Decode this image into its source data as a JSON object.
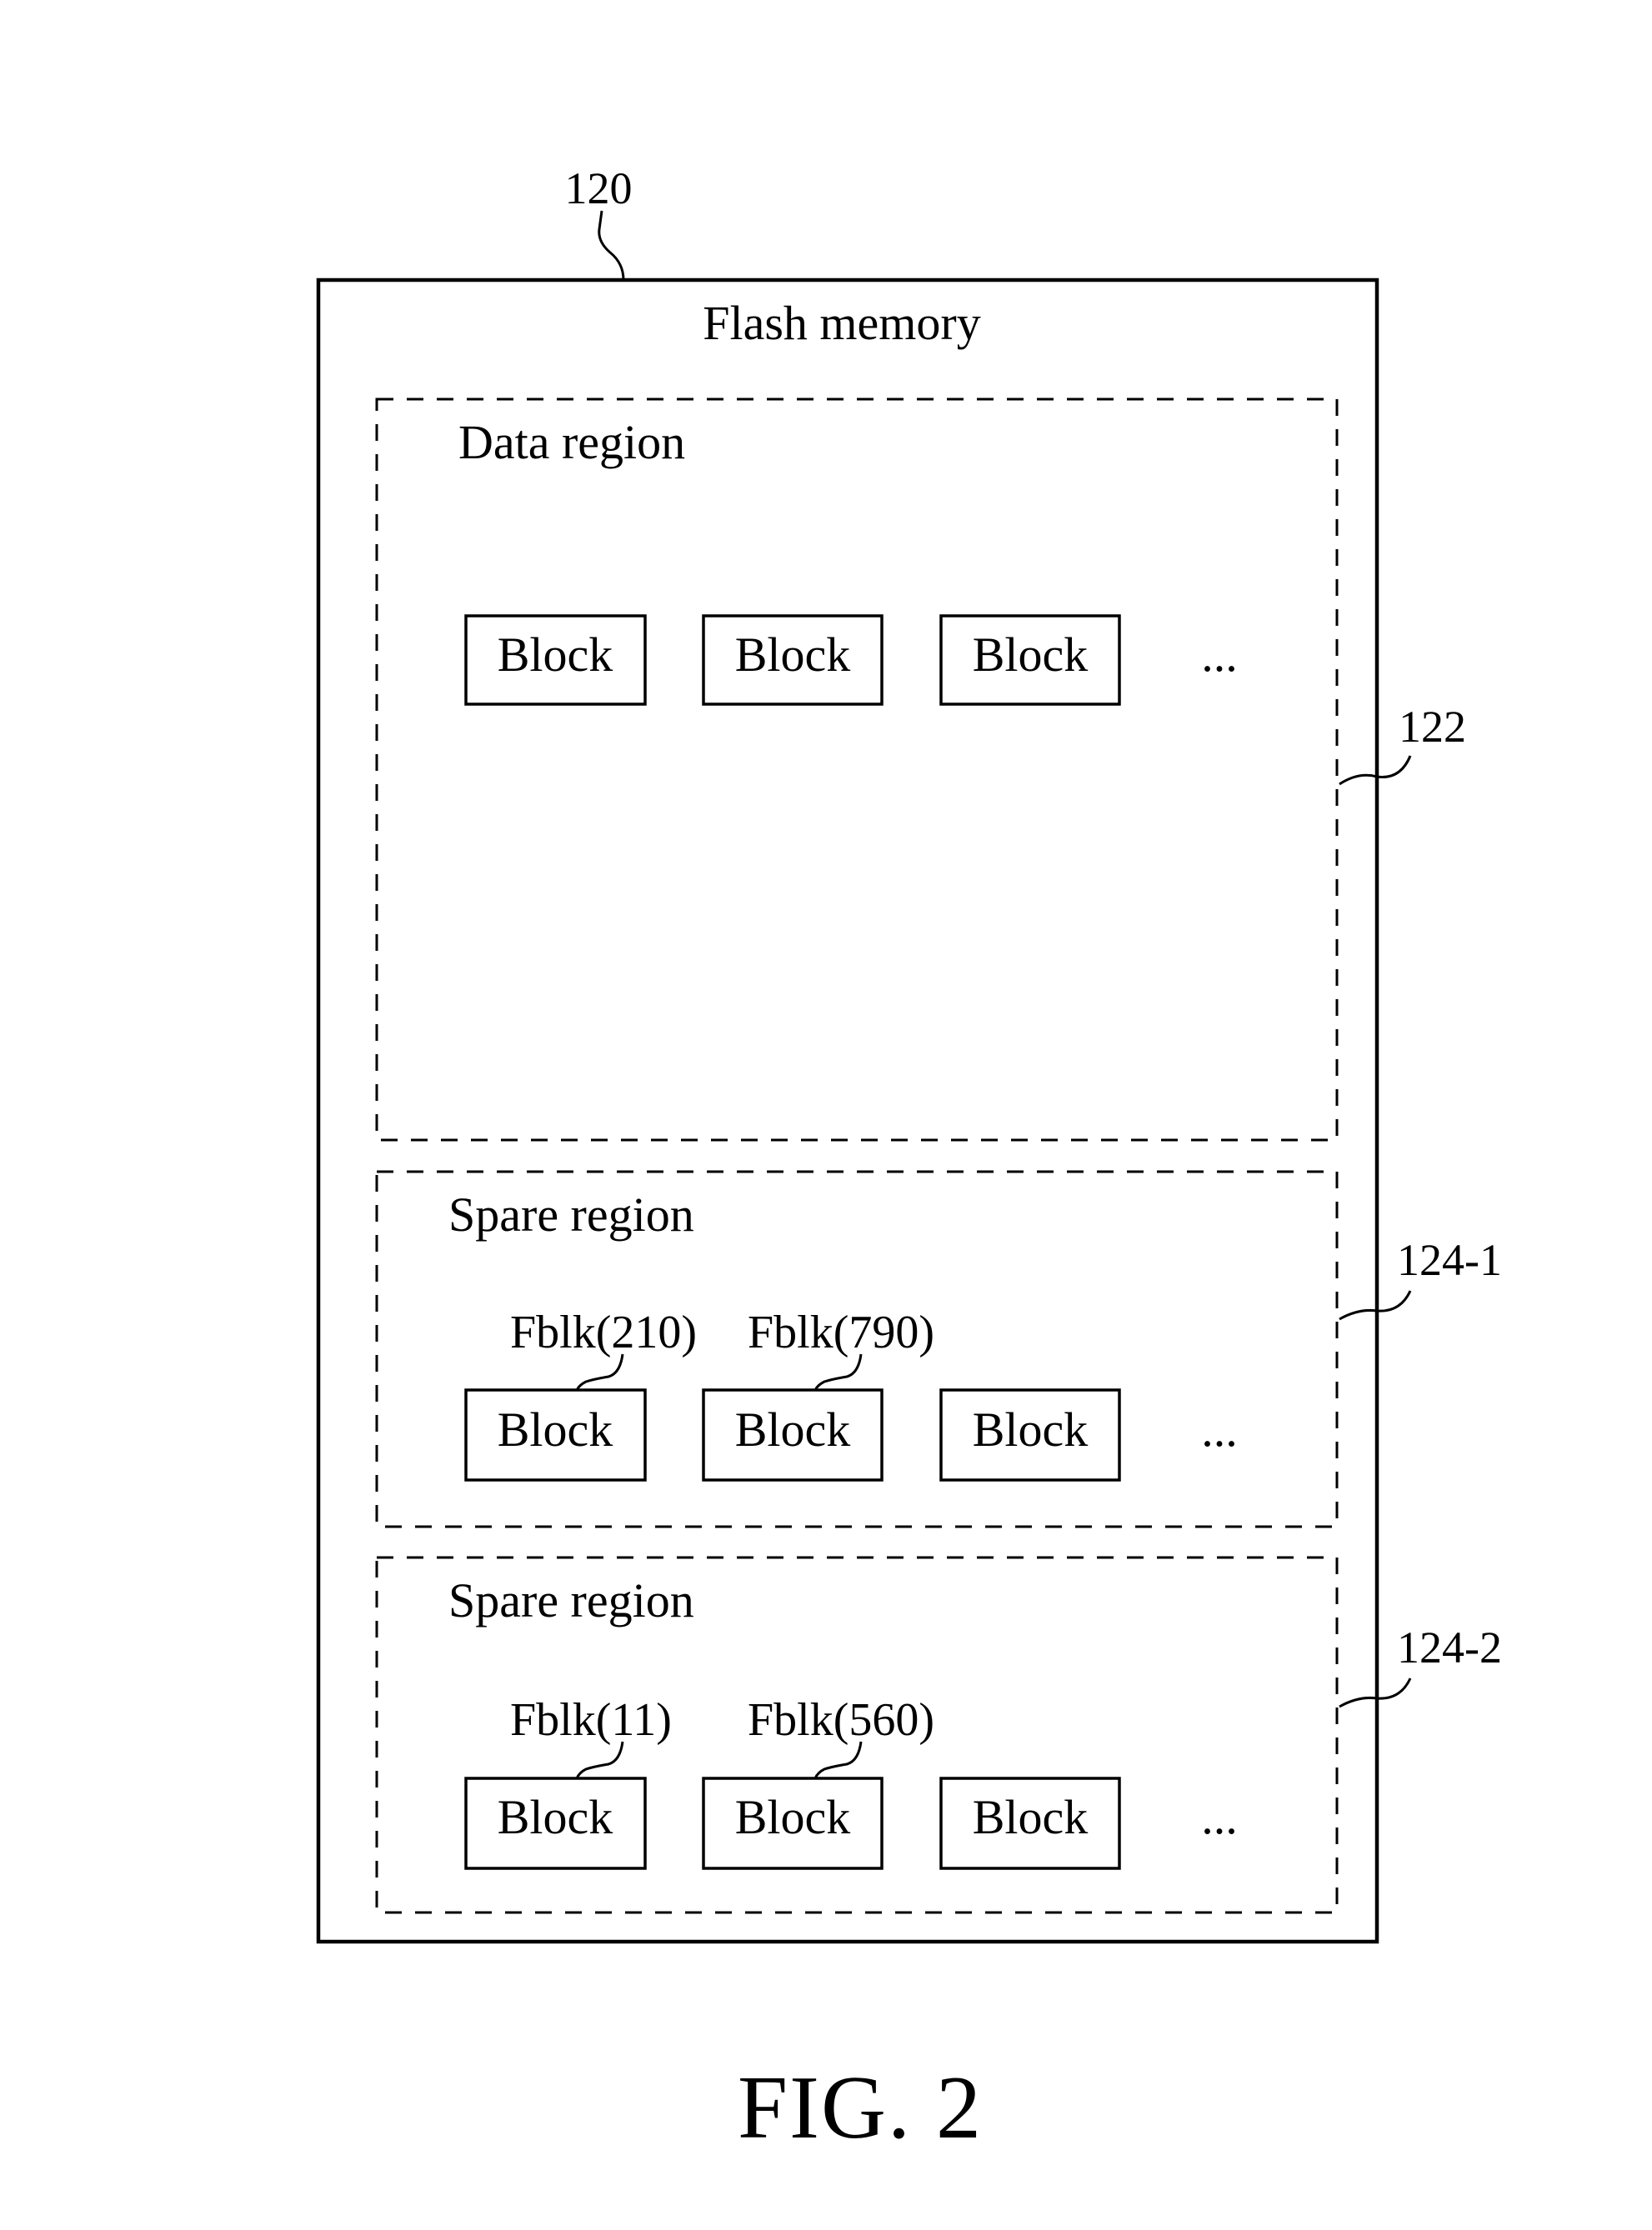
{
  "figure": {
    "caption": "FIG. 2",
    "container": {
      "ref": "120",
      "title": "Flash memory"
    },
    "regions": [
      {
        "id": "data-region",
        "ref": "122",
        "title": "Data region",
        "blocks": [
          {
            "label": "Block",
            "tag": null
          },
          {
            "label": "Block",
            "tag": null
          },
          {
            "label": "Block",
            "tag": null
          }
        ],
        "ellipsis": "..."
      },
      {
        "id": "spare-region-1",
        "ref": "124-1",
        "title": "Spare region",
        "blocks": [
          {
            "label": "Block",
            "tag": "Fblk(210)"
          },
          {
            "label": "Block",
            "tag": "Fblk(790)"
          },
          {
            "label": "Block",
            "tag": null
          }
        ],
        "ellipsis": "..."
      },
      {
        "id": "spare-region-2",
        "ref": "124-2",
        "title": "Spare region",
        "blocks": [
          {
            "label": "Block",
            "tag": "Fblk(11)"
          },
          {
            "label": "Block",
            "tag": "Fblk(560)"
          },
          {
            "label": "Block",
            "tag": null
          }
        ],
        "ellipsis": "..."
      }
    ]
  }
}
